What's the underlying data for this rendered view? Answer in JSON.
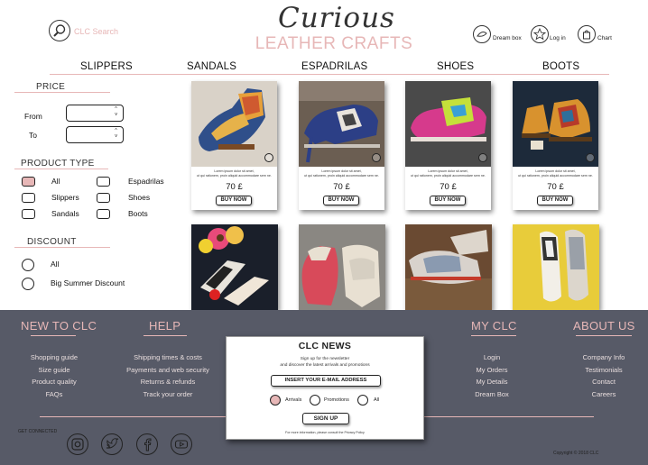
{
  "header": {
    "search_label": "CLC Search",
    "logo_script": "Curious",
    "logo_sub": "LEATHER CRAFTS",
    "dream_box": "Dream box",
    "login": "Log in",
    "cart": "Chart"
  },
  "nav": [
    "SLIPPERS",
    "SANDALS",
    "ESPADRILAS",
    "SHOES",
    "BOOTS"
  ],
  "filters": {
    "price": {
      "title": "PRICE",
      "from": "From",
      "to": "To"
    },
    "product_type": {
      "title": "PRODUCT TYPE",
      "options": [
        {
          "label": "All",
          "checked": true
        },
        {
          "label": "Espadrilas",
          "checked": false
        },
        {
          "label": "Slippers",
          "checked": false
        },
        {
          "label": "Shoes",
          "checked": false
        },
        {
          "label": "Sandals",
          "checked": false
        },
        {
          "label": "Boots",
          "checked": false
        }
      ]
    },
    "discount": {
      "title": "DISCOUNT",
      "options": [
        "All",
        "Big Summer Discount"
      ]
    }
  },
  "products": [
    {
      "desc1": "Lorem ipsum dolor sit amet,",
      "desc2": "ut qui rationem, proin aliquid accommodare sem ne.",
      "price": "70 £",
      "buy": "BUY NOW"
    },
    {
      "desc1": "Lorem ipsum dolor sit amet,",
      "desc2": "ut qui rationem, proin aliquid accommodare sem ne.",
      "price": "70 £",
      "buy": "BUY NOW"
    },
    {
      "desc1": "Lorem ipsum dolor sit amet,",
      "desc2": "ut qui rationem, proin aliquid accommodare sem ne.",
      "price": "70 £",
      "buy": "BUY NOW"
    },
    {
      "desc1": "Lorem ipsum dolor sit amet,",
      "desc2": "ut qui rationem, proin aliquid accommodare sem ne.",
      "price": "70 £",
      "buy": "BUY NOW"
    }
  ],
  "footer": {
    "new_to_clc": {
      "title": "NEW TO CLC",
      "links": [
        "Shopping guide",
        "Size guide",
        "Product quality",
        "FAQs"
      ]
    },
    "help": {
      "title": "HELP",
      "links": [
        "Shipping times & costs",
        "Payments and web security",
        "Returns & refunds",
        "Track your order"
      ]
    },
    "my_clc": {
      "title": "MY CLC",
      "links": [
        "Login",
        "My Orders",
        "My Details",
        "Dream Box"
      ]
    },
    "about_us": {
      "title": "ABOUT US",
      "links": [
        "Company Info",
        "Testimonials",
        "Contact",
        "Careers"
      ]
    },
    "get_connected": "GET CONNECTED",
    "copyright": "Copyright © 2018 CLC",
    "social_icons": [
      "instagram-icon",
      "twitter-icon",
      "facebook-icon",
      "youtube-icon"
    ]
  },
  "newsletter": {
    "title": "CLC NEWS",
    "line1": "Sign up for the newsletter",
    "line2": "and discover the latest arrivals and promotions",
    "email_button": "INSERT YOUR E-MAIL ADDRESS",
    "options": [
      {
        "label": "Arrivals",
        "selected": true
      },
      {
        "label": "Promotions",
        "selected": false
      },
      {
        "label": "All",
        "selected": false
      }
    ],
    "signup": "SIGN UP",
    "fine_print": "For more information, please consult the Privacy Policy"
  },
  "colors": {
    "accent": "#e7b7b7",
    "footer_bg": "#575a67"
  }
}
